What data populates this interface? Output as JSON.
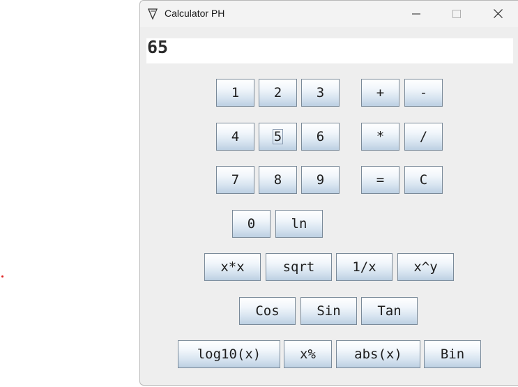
{
  "window": {
    "title": "Calculator PH"
  },
  "display": {
    "value": "65"
  },
  "buttons": {
    "one": "1",
    "two": "2",
    "three": "3",
    "plus": "+",
    "minus": "-",
    "four": "4",
    "five": "5",
    "six": "6",
    "multiply": "*",
    "divide": "/",
    "seven": "7",
    "eight": "8",
    "nine": "9",
    "equals": "=",
    "clear": "C",
    "zero": "0",
    "ln": "ln",
    "square": "x*x",
    "sqrt": "sqrt",
    "reciprocal": "1/x",
    "power": "x^y",
    "cos": "Cos",
    "sin": "Sin",
    "tan": "Tan",
    "log10": "log10(x)",
    "percent": "x%",
    "abs": "abs(x)",
    "bin": "Bin"
  },
  "colors": {
    "window_bg": "#eeeeee",
    "button_top": "#ffffff",
    "button_bottom": "#bccfe2",
    "button_border": "#7a8a99"
  }
}
